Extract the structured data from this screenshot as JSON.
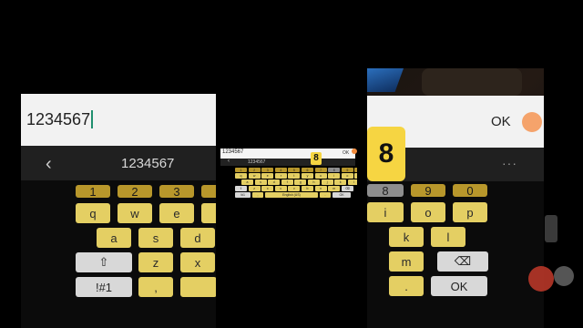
{
  "left": {
    "input_text": "1234567",
    "back_icon": "‹",
    "suggestion": "1234567",
    "keyboard": {
      "numbers": [
        "1",
        "2",
        "3"
      ],
      "row1": [
        "q",
        "w",
        "e"
      ],
      "row2": [
        "a",
        "s",
        "d"
      ],
      "row3": [
        "⇧",
        "z",
        "x"
      ],
      "row4": [
        "!#1",
        ","
      ]
    }
  },
  "center": {
    "input_text": "1234567",
    "ok": "OK",
    "suggestion": "1234567",
    "back_icon": "‹",
    "popup_key": "8",
    "numbers": [
      "1",
      "2",
      "3",
      "4",
      "5",
      "6",
      "7",
      "8",
      "9",
      "0"
    ],
    "row1": [
      "q",
      "w",
      "e",
      "r",
      "t",
      "y",
      "u",
      "i",
      "o",
      "p"
    ],
    "row2": [
      "a",
      "s",
      "d",
      "f",
      "g",
      "h",
      "j",
      "k",
      "l"
    ],
    "row3": [
      "⇧",
      "z",
      "x",
      "c",
      "v",
      "b",
      "n",
      "m",
      "⌫"
    ],
    "row4": [
      "!#1",
      ",",
      "English (US)",
      ".",
      "OK"
    ]
  },
  "right": {
    "ok": "OK",
    "more": "···",
    "popup_key": "8",
    "keyboard": {
      "numbers": [
        "8",
        "9",
        "0"
      ],
      "row1": [
        "i",
        "o",
        "p"
      ],
      "row2": [
        "k",
        "l"
      ],
      "row3": [
        "m",
        "⌫"
      ],
      "row4": [
        ".",
        "OK"
      ]
    }
  },
  "colors": {
    "number_key": "#b8972b",
    "letter_key": "#e4cf63",
    "function_key": "#d8d8d8",
    "popup": "#f6d542"
  }
}
